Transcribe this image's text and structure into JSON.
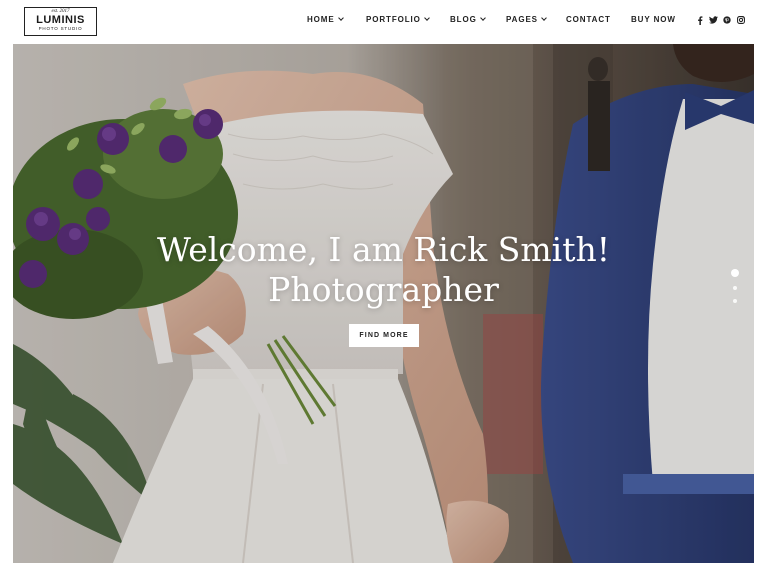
{
  "brand": {
    "est": "est. 2017",
    "name": "LUMINIS",
    "tagline": "PHOTO STUDIO"
  },
  "nav": {
    "items": [
      {
        "label": "HOME",
        "dropdown": true
      },
      {
        "label": "PORTFOLIO",
        "dropdown": true
      },
      {
        "label": "BLOG",
        "dropdown": true
      },
      {
        "label": "PAGES",
        "dropdown": true
      },
      {
        "label": "CONTACT",
        "dropdown": false
      },
      {
        "label": "BUY NOW",
        "dropdown": false
      }
    ]
  },
  "social": [
    "facebook-icon",
    "twitter-icon",
    "pinterest-icon",
    "instagram-icon"
  ],
  "hero": {
    "title_line1": "Welcome, I am Rick Smith!",
    "title_line2": "Photographer",
    "cta_label": "FIND MORE",
    "slides_total": 3,
    "active_slide": 1
  },
  "colors": {
    "text": "#222222",
    "background": "#ffffff",
    "hero_text": "#ffffff"
  }
}
